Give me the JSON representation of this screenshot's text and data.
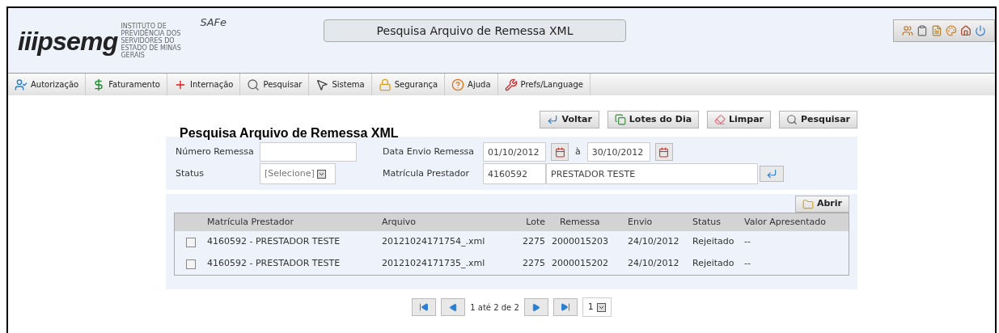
{
  "header": {
    "logo": "iiipsemg",
    "logo_caption": "INSTITUTO DE PREVIDÊNCIA DOS SERVIDORES DO ESTADO DE MINAS GERAIS",
    "app_name": "SAFe",
    "page_title": "Pesquisa Arquivo de Remessa XML"
  },
  "menu": [
    {
      "label": "Autorização",
      "kind": "user"
    },
    {
      "label": "Faturamento",
      "kind": "money"
    },
    {
      "label": "Internação",
      "kind": "cross"
    },
    {
      "label": "Pesquisar",
      "kind": "search"
    },
    {
      "label": "Sistema",
      "kind": "mouse"
    },
    {
      "label": "Segurança",
      "kind": "lock"
    },
    {
      "label": "Ajuda",
      "kind": "help"
    },
    {
      "label": "Prefs/Language",
      "kind": "tools"
    }
  ],
  "actions": [
    {
      "label": "Voltar",
      "kind": "back"
    },
    {
      "label": "Lotes do Dia",
      "kind": "copies"
    },
    {
      "label": "Limpar",
      "kind": "eraser"
    },
    {
      "label": "Pesquisar",
      "kind": "search"
    }
  ],
  "form": {
    "title": "Pesquisa Arquivo de Remessa XML",
    "numero_label": "Número Remessa",
    "status_label": "Status",
    "status_value": "[Selecione]",
    "data_label": "Data Envio Remessa",
    "date_from": "01/10/2012",
    "date_sep": "à",
    "date_to": "30/10/2012",
    "matricula_label": "Matrícula Prestador",
    "matricula": "4160592",
    "prestador": "PRESTADOR TESTE"
  },
  "results": {
    "open_button": "Abrir",
    "columns": [
      "Matrícula Prestador",
      "Arquivo",
      "Lote",
      "Remessa",
      "Envio",
      "Status",
      "Valor Apresentado"
    ],
    "rows": [
      {
        "checked": false,
        "cells": [
          "4160592 - PRESTADOR TESTE",
          "20121024171754_.xml",
          "2275",
          "2000015203",
          "24/10/2012",
          "Rejeitado",
          "--"
        ]
      },
      {
        "checked": false,
        "cells": [
          "4160592 - PRESTADOR TESTE",
          "20121024171735_.xml",
          "2275",
          "2000015202",
          "24/10/2012",
          "Rejeitado",
          "--"
        ]
      }
    ]
  },
  "pagination": {
    "info": "1 até 2 de 2",
    "page": "1"
  }
}
